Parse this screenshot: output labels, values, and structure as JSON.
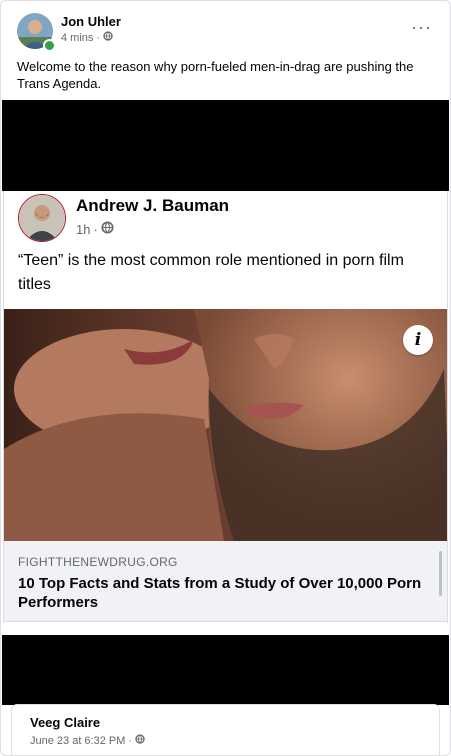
{
  "post": {
    "author": "Jon Uhler",
    "time": "4 mins",
    "text": "Welcome to the reason why porn-fueled men-in-drag are pushing the Trans Agenda.",
    "more_icon": "more-horizontal-icon",
    "privacy_icon": "globe-icon"
  },
  "shared_post": {
    "author": "Andrew J. Bauman",
    "time": "1h",
    "privacy_icon": "globe-icon",
    "text": "“Teen” is the most common role mentioned in porn film titles",
    "link": {
      "domain": "FIGHTTHENEWDRUG.ORG",
      "title": "10 Top Facts and Stats from a Study of Over 10,000 Porn Performers",
      "info_icon": "info-icon"
    }
  },
  "next_post": {
    "author": "Veeg Claire",
    "time": "June 23 at 6:32 PM",
    "privacy_icon": "globe-icon"
  },
  "colors": {
    "online": "#31a24c",
    "meta_gray": "#65676b",
    "caption_bg": "#f0f2f5",
    "redaction": "#000000"
  }
}
